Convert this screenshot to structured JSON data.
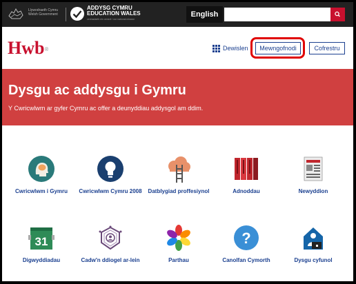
{
  "topbar": {
    "gov_text": [
      "Llywodraeth Cymru",
      "Welsh Government"
    ],
    "edu_title": [
      "ADDYSG CYMRU",
      "EDUCATION WALES"
    ],
    "edu_subtitle": "cenhadaeth ein cenedl / our national mission",
    "language_button": "English",
    "search_value": ""
  },
  "header": {
    "logo": "Hwb",
    "logo_mark": "®",
    "menu_label": "Dewislen",
    "login_label": "Mewngofnodi",
    "register_label": "Cofrestru",
    "highlight_color": "#e00000"
  },
  "banner": {
    "title": "Dysgu ac addysgu i Gymru",
    "subtitle": "Y Cwricwlwm ar gyfer Cymru ac offer a deunyddiau addysgol am ddim.",
    "color": "#d04040"
  },
  "tiles": [
    {
      "label": "Cwricwlwm i Gymru",
      "icon": "head-icon"
    },
    {
      "label": "Cwricwlwm Cymru 2008",
      "icon": "lightbulb-icon"
    },
    {
      "label": "Datblygiad proffesiynol",
      "icon": "cloud-ladder-icon"
    },
    {
      "label": "Adnoddau",
      "icon": "books-icon"
    },
    {
      "label": "Newyddion",
      "icon": "newspaper-icon"
    },
    {
      "label": "Digwyddiadau",
      "icon": "calendar-icon",
      "calendar_day": "31"
    },
    {
      "label": "Cadw'n ddiogel ar-lein",
      "icon": "safety-badge-icon"
    },
    {
      "label": "Parthau",
      "icon": "pinwheel-icon"
    },
    {
      "label": "Canolfan Cymorth",
      "icon": "help-icon",
      "glyph": "?"
    },
    {
      "label": "Dysgu cyfunol",
      "icon": "home-learning-icon"
    }
  ],
  "colors": {
    "brand_red": "#c8102e",
    "link_blue": "#1a3f8f"
  }
}
